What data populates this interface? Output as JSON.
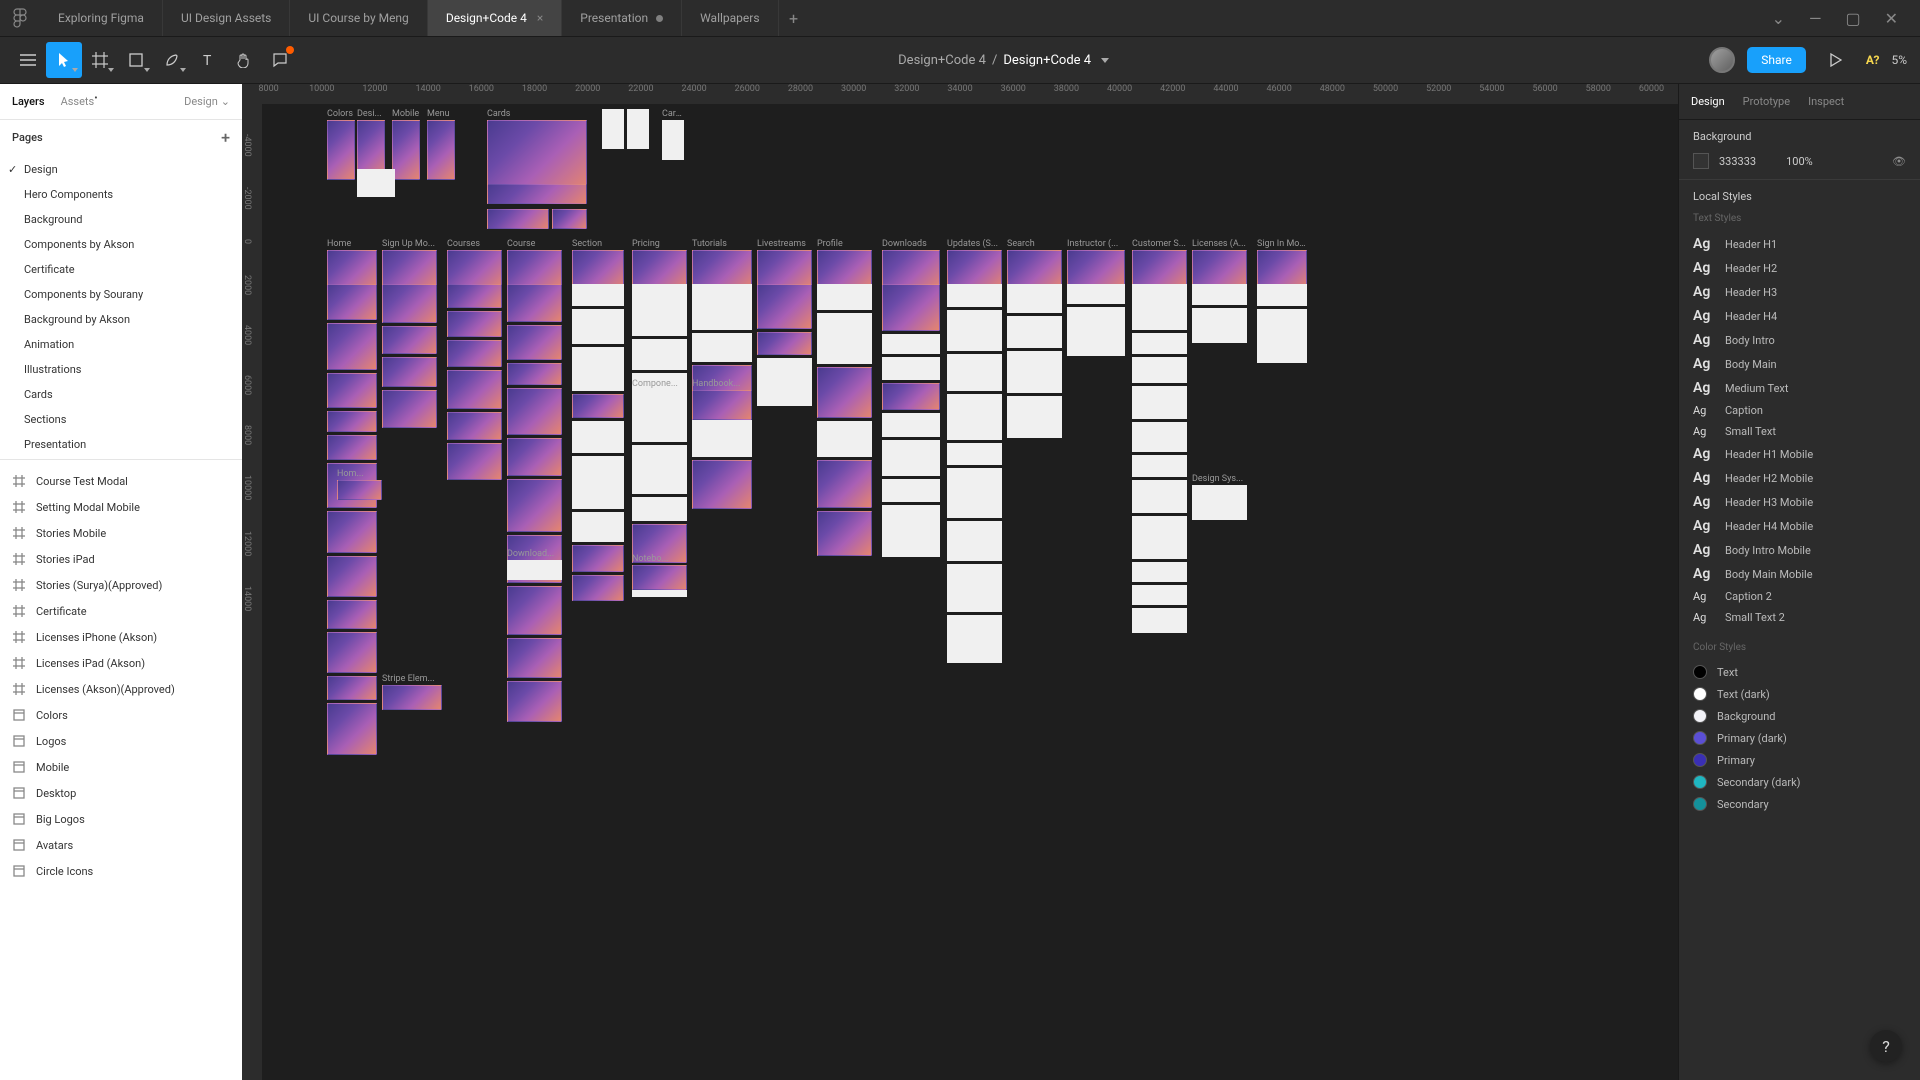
{
  "tabs": [
    {
      "label": "Exploring Figma",
      "active": false
    },
    {
      "label": "UI Design Assets",
      "active": false
    },
    {
      "label": "UI Course by Meng",
      "active": false
    },
    {
      "label": "Design+Code 4",
      "active": true
    },
    {
      "label": "Presentation",
      "active": false,
      "dot": true
    },
    {
      "label": "Wallpapers",
      "active": false
    }
  ],
  "breadcrumb": {
    "project": "Design+Code 4",
    "file": "Design+Code 4"
  },
  "share_label": "Share",
  "zoom": "5%",
  "a_question": "A?",
  "left_tabs": {
    "layers": "Layers",
    "assets": "Assets",
    "filter": "Design"
  },
  "pages_header": "Pages",
  "pages": [
    {
      "name": "Design",
      "checked": true
    },
    {
      "name": "Hero Components"
    },
    {
      "name": "Background"
    },
    {
      "name": "Components by Akson"
    },
    {
      "name": "Certificate"
    },
    {
      "name": "Components by Sourany"
    },
    {
      "name": "Background by Akson"
    },
    {
      "name": "Animation"
    },
    {
      "name": "Illustrations"
    },
    {
      "name": "Cards"
    },
    {
      "name": "Sections"
    },
    {
      "name": "Presentation"
    }
  ],
  "frames": [
    {
      "name": "Course Test Modal",
      "icon": "grid"
    },
    {
      "name": "Setting Modal Mobile",
      "icon": "grid"
    },
    {
      "name": "Stories Mobile",
      "icon": "grid"
    },
    {
      "name": "Stories iPad",
      "icon": "grid"
    },
    {
      "name": "Stories (Surya)(Approved)",
      "icon": "grid"
    },
    {
      "name": "Certificate",
      "icon": "grid"
    },
    {
      "name": "Licenses iPhone (Akson)",
      "icon": "grid"
    },
    {
      "name": "Licenses iPad (Akson)",
      "icon": "grid"
    },
    {
      "name": "Licenses (Akson)(Approved)",
      "icon": "grid"
    },
    {
      "name": "Colors",
      "icon": "frame"
    },
    {
      "name": "Logos",
      "icon": "frame"
    },
    {
      "name": "Mobile",
      "icon": "frame"
    },
    {
      "name": "Desktop",
      "icon": "frame"
    },
    {
      "name": "Big Logos",
      "icon": "frame"
    },
    {
      "name": "Avatars",
      "icon": "frame"
    },
    {
      "name": "Circle Icons",
      "icon": "frame"
    }
  ],
  "right_tabs": {
    "design": "Design",
    "prototype": "Prototype",
    "inspect": "Inspect"
  },
  "background_section": {
    "label": "Background",
    "hex": "333333",
    "opacity": "100%"
  },
  "local_styles_label": "Local Styles",
  "text_styles_label": "Text Styles",
  "text_styles": [
    {
      "name": "Header H1"
    },
    {
      "name": "Header H2"
    },
    {
      "name": "Header H3"
    },
    {
      "name": "Header H4"
    },
    {
      "name": "Body Intro"
    },
    {
      "name": "Body Main"
    },
    {
      "name": "Medium Text"
    },
    {
      "name": "Caption",
      "sm": true
    },
    {
      "name": "Small Text",
      "sm": true
    },
    {
      "name": "Header H1 Mobile"
    },
    {
      "name": "Header H2 Mobile"
    },
    {
      "name": "Header H3 Mobile"
    },
    {
      "name": "Header H4 Mobile"
    },
    {
      "name": "Body Intro Mobile"
    },
    {
      "name": "Body Main Mobile"
    },
    {
      "name": "Caption 2",
      "sm": true
    },
    {
      "name": "Small Text 2",
      "sm": true
    }
  ],
  "color_styles_label": "Color Styles",
  "color_styles": [
    {
      "name": "Text",
      "hex": "#000000"
    },
    {
      "name": "Text (dark)",
      "hex": "#ffffff"
    },
    {
      "name": "Background",
      "hex": "#f2f2f7"
    },
    {
      "name": "Primary (dark)",
      "hex": "#5b4fd6"
    },
    {
      "name": "Primary",
      "hex": "#3a2fb5"
    },
    {
      "name": "Secondary (dark)",
      "hex": "#1fb6c1"
    },
    {
      "name": "Secondary",
      "hex": "#14919b"
    }
  ],
  "ruler_marks_h": [
    "8000",
    "10000",
    "12000",
    "14000",
    "16000",
    "18000",
    "20000",
    "22000",
    "24000",
    "26000",
    "28000",
    "30000",
    "32000",
    "34000",
    "36000",
    "38000",
    "40000",
    "42000",
    "44000",
    "46000",
    "48000",
    "50000",
    "52000",
    "54000",
    "56000",
    "58000",
    "60000"
  ],
  "ruler_marks_v": [
    "-4000",
    "-2000",
    "0",
    "2000",
    "4000",
    "6000",
    "8000",
    "10000",
    "12000",
    "14000"
  ],
  "canvas_row1_labels": [
    "Colors",
    "Desi...",
    "Mobile",
    "Menu",
    "Cards",
    "",
    "",
    "Cards"
  ],
  "canvas_row2_labels": [
    "Home",
    "Sign Up Mo...",
    "Courses",
    "Course",
    "Section",
    "Pricing",
    "Tutorials",
    "Livestreams",
    "Profile",
    "Downloads",
    "Updates (S...",
    "Search",
    "Instructor (...",
    "Customer S...",
    "Licenses (A...",
    "Sign In Modal"
  ],
  "canvas_extra_labels": {
    "compone": "Compone...",
    "handbook": "Handbook...",
    "hom": "Hom...",
    "download": "Download...",
    "notebo": "Notebo...",
    "stripe": "Stripe Elem...",
    "designsys": "Design Sys..."
  }
}
